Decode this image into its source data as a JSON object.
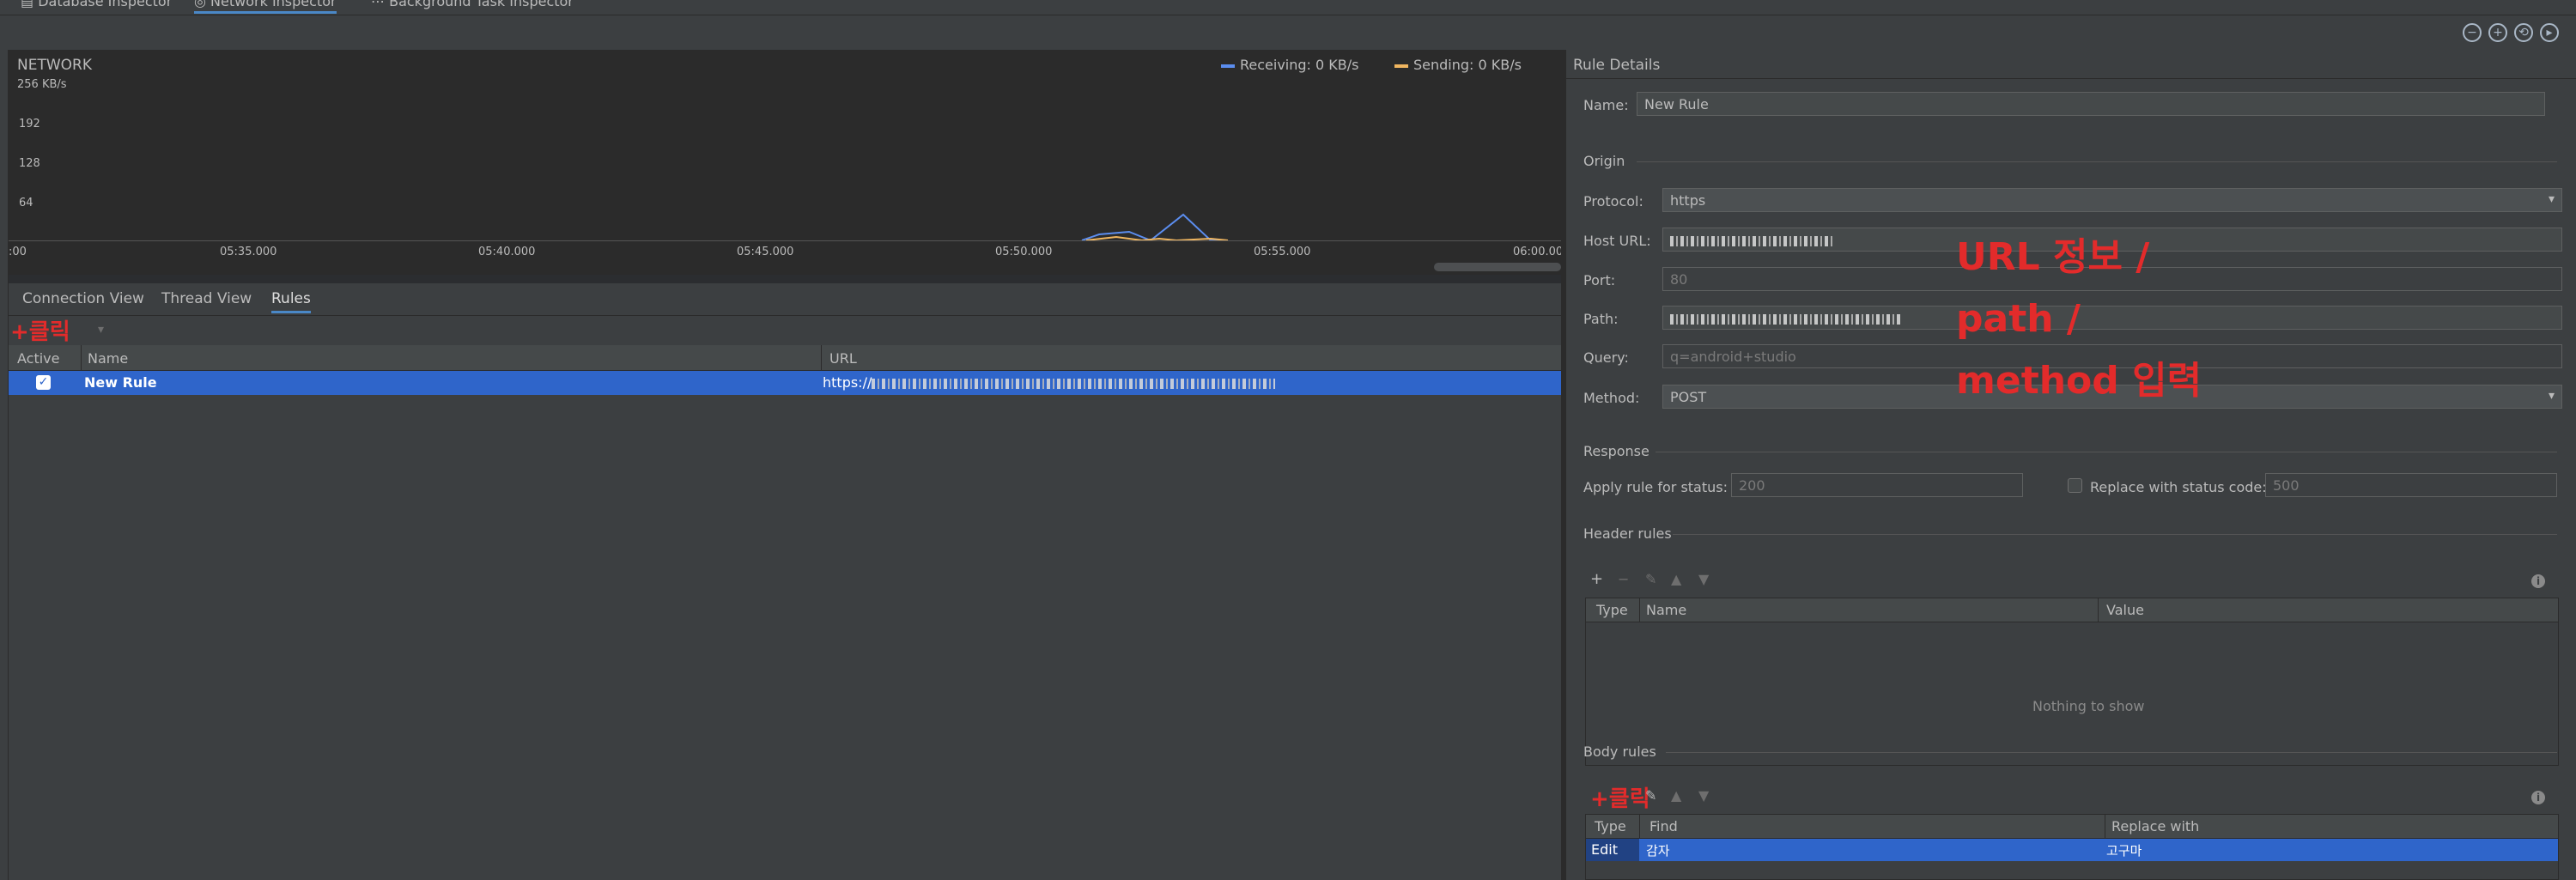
{
  "top_tabs": [
    {
      "label": "Database Inspector",
      "icon": "database-icon"
    },
    {
      "label": "Network Inspector",
      "icon": "network-icon"
    },
    {
      "label": "Background Task Inspector",
      "icon": "background-task-icon"
    }
  ],
  "toolbar_icons": [
    "zoom-out-icon",
    "zoom-in-icon",
    "reset-zoom-icon",
    "go-live-icon"
  ],
  "chart": {
    "title": "NETWORK",
    "unit": "256 KB/s",
    "yticks": [
      "192",
      "128",
      "64"
    ],
    "legend": [
      {
        "label": "Receiving: 0 KB/s",
        "color": "#5b8def"
      },
      {
        "label": "Sending: 0 KB/s",
        "color": "#f0b660"
      }
    ],
    "xticks": [
      ":00",
      "05:35.000",
      "05:40.000",
      "05:45.000",
      "05:50.000",
      "05:55.000",
      "06:00.00"
    ]
  },
  "sub_tabs": [
    {
      "label": "Connection View"
    },
    {
      "label": "Thread View"
    },
    {
      "label": "Rules"
    }
  ],
  "annotations": {
    "click_add_rule": "+클릭",
    "url_info": [
      "URL 정보 /",
      "path /",
      "method 입력"
    ],
    "click_body": "+클릭"
  },
  "rules_table": {
    "columns": [
      "Active",
      "Name",
      "URL"
    ],
    "rows": [
      {
        "active": true,
        "name": "New Rule",
        "url_prefix": "https://"
      }
    ]
  },
  "rule_details": {
    "title": "Rule Details",
    "name_label": "Name:",
    "name_value": "New Rule",
    "origin_section": "Origin",
    "protocol_label": "Protocol:",
    "protocol_value": "https",
    "host_label": "Host URL:",
    "port_label": "Port:",
    "port_placeholder": "80",
    "path_label": "Path:",
    "query_label": "Query:",
    "query_placeholder": "q=android+studio",
    "method_label": "Method:",
    "method_value": "POST",
    "response_section": "Response",
    "apply_status_label": "Apply rule for status:",
    "apply_status_placeholder": "200",
    "replace_status_label": "Replace with status code:",
    "replace_status_placeholder": "500",
    "header_rules_section": "Header rules",
    "header_columns": [
      "Type",
      "Name",
      "Value"
    ],
    "header_empty": "Nothing to show",
    "body_rules_section": "Body rules",
    "body_columns": [
      "Type",
      "Find",
      "Replace with"
    ],
    "body_rows": [
      {
        "type": "Edit",
        "find": "감자",
        "replace": "고구마"
      }
    ]
  }
}
